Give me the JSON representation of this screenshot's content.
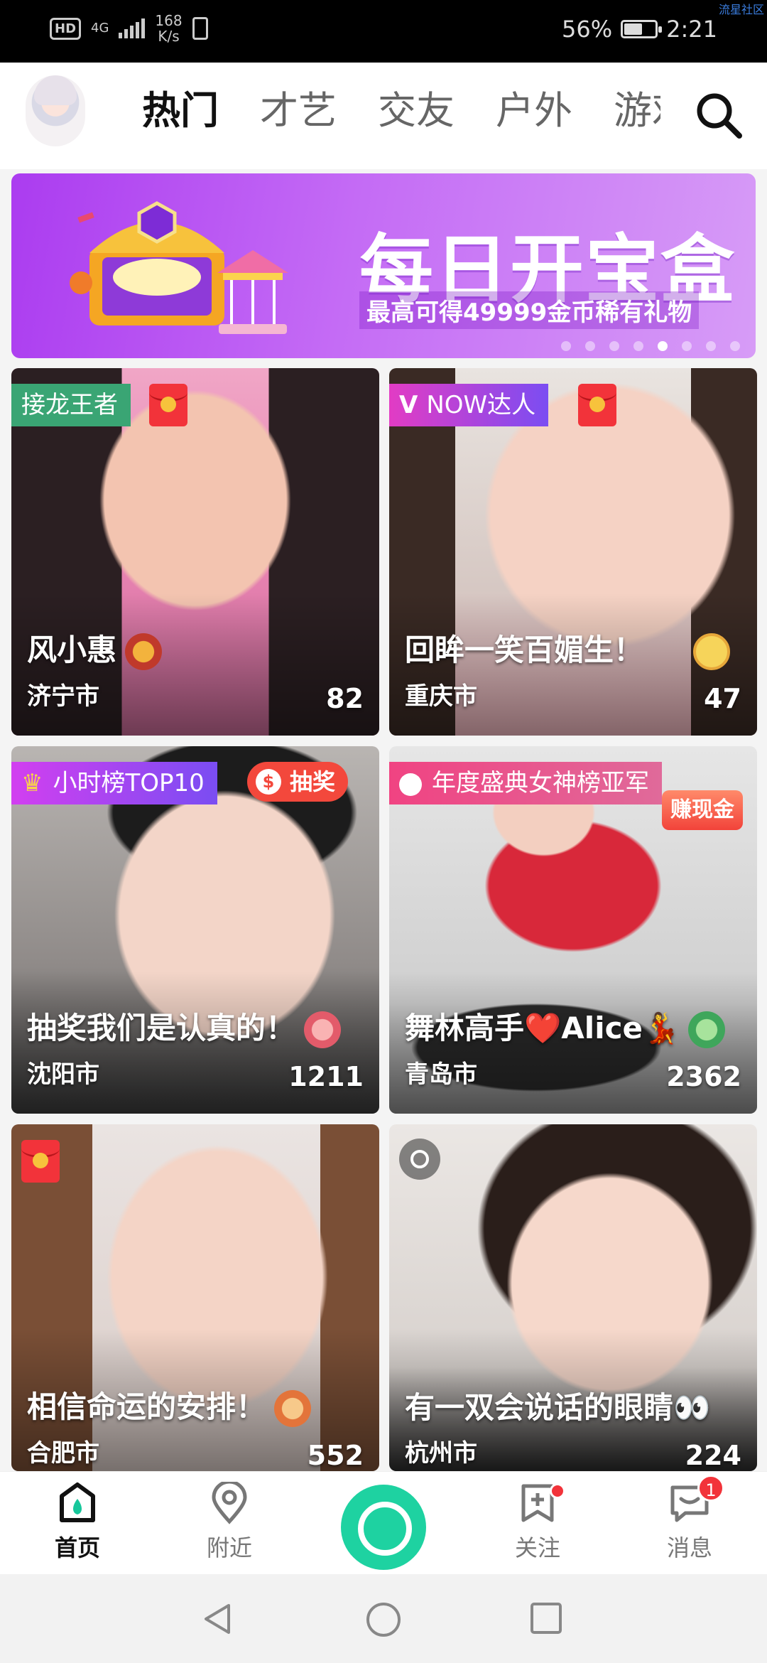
{
  "status_bar": {
    "hd": "HD",
    "network": "4G",
    "speed_value": "168",
    "speed_unit": "K/s",
    "battery": "56%",
    "battery_level": 0.56,
    "time": "2:21",
    "watermark": "流星社区"
  },
  "header": {
    "tabs": [
      {
        "label": "热门",
        "active": true
      },
      {
        "label": "才艺",
        "active": false
      },
      {
        "label": "交友",
        "active": false
      },
      {
        "label": "户外",
        "active": false
      },
      {
        "label": "游戏",
        "active": false
      }
    ]
  },
  "banner": {
    "title": "每日开宝盒",
    "subtitle": "最高可得49999金币稀有礼物",
    "dot_count": 8,
    "active_dot": 4
  },
  "feed": [
    {
      "tag": "接龙王者",
      "tag_color": "#3aa574",
      "red_packet": true,
      "name": "风小惠",
      "city": "济宁市",
      "viewers": "82"
    },
    {
      "tag": "NOW达人",
      "tag_icon": "V",
      "tag_color": "#9b4df2",
      "red_packet": true,
      "name": "回眸一笑百媚生！",
      "city": "重庆市",
      "viewers": "47"
    },
    {
      "tag": "小时榜TOP10",
      "tag_color": "#8a4df0",
      "lottery_label": "抽奖",
      "name": "抽奖我们是认真的！",
      "city": "沈阳市",
      "viewers": "1211"
    },
    {
      "tag": "年度盛典女神榜亚军",
      "tag_color": "#e9407a",
      "promo_label": "赚现金",
      "name": "舞林高手❤️Alice💃",
      "city": "青岛市",
      "viewers": "2362"
    },
    {
      "red_packet": true,
      "name": "相信命运的安排！",
      "city": "合肥市",
      "viewers": "552"
    },
    {
      "name": "有一双会说话的眼睛👀",
      "city": "杭州市",
      "viewers": "224"
    }
  ],
  "bottom_nav": {
    "items": [
      {
        "label": "首页",
        "icon": "home-icon",
        "active": true
      },
      {
        "label": "附近",
        "icon": "location-icon",
        "active": false
      },
      {
        "label": "关注",
        "icon": "follow-icon",
        "active": false,
        "dot": true
      },
      {
        "label": "消息",
        "icon": "message-icon",
        "active": false,
        "badge": "1"
      }
    ]
  },
  "colors": {
    "accent": "#17c79b",
    "live_button": "#1ed2a1",
    "badge": "#f2333a"
  }
}
